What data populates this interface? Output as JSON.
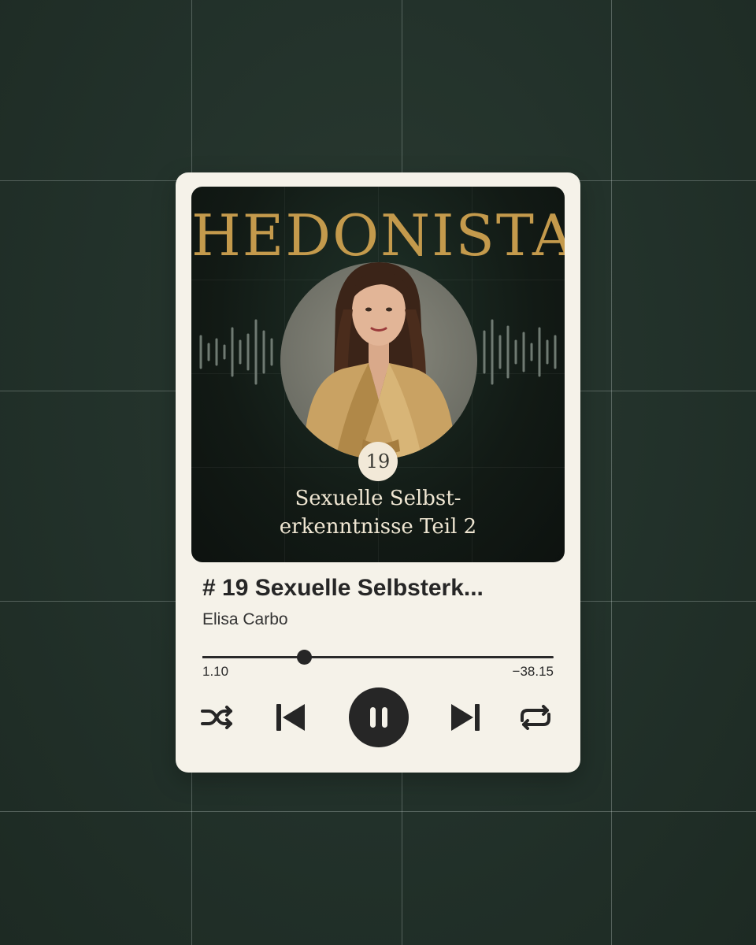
{
  "cover": {
    "brand": "HEDONISTA",
    "episode_number": "19",
    "title_line1": "Sexuelle Selbst-",
    "title_line2": "erkenntnisse Teil 2"
  },
  "track": {
    "title": "# 19 Sexuelle Selbsterk...",
    "artist": "Elisa Carbo"
  },
  "playback": {
    "elapsed": "1.10",
    "remaining": "−38.15",
    "progress_fraction": 0.29,
    "state": "playing"
  },
  "controls": {
    "shuffle_icon": "shuffle-icon",
    "prev_icon": "skip-previous-icon",
    "play_pause_icon": "pause-icon",
    "next_icon": "skip-next-icon",
    "repeat_icon": "repeat-icon"
  },
  "colors": {
    "background": "#223129",
    "card": "#f5f2e9",
    "brand_gold": "#c49a4c",
    "cover_dark": "#121a15",
    "text_dark": "#262626"
  }
}
